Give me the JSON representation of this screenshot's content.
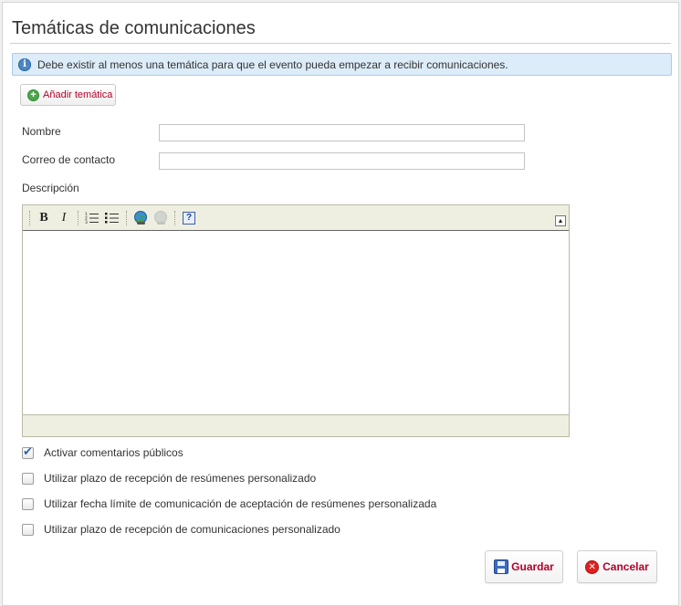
{
  "page": {
    "title": "Temáticas de comunicaciones"
  },
  "info": {
    "message": "Debe existir al menos una temática para que el evento pueda empezar a recibir comunicaciones.",
    "icon": "info-icon"
  },
  "add_button": {
    "label": "Añadir temática",
    "icon": "plus-circle-icon"
  },
  "form": {
    "name_label": "Nombre",
    "name_value": "",
    "email_label": "Correo de contacto",
    "email_value": "",
    "description_label": "Descripción",
    "description_value": ""
  },
  "editor_toolbar": {
    "bold": "B",
    "italic": "I",
    "help": "?",
    "tools": [
      "bold-icon",
      "italic-icon",
      "ordered-list-icon",
      "unordered-list-icon",
      "link-icon",
      "unlink-icon",
      "help-icon"
    ]
  },
  "checkboxes": [
    {
      "label": "Activar comentarios públicos",
      "checked": true
    },
    {
      "label": "Utilizar plazo de recepción de resúmenes personalizado",
      "checked": false
    },
    {
      "label": "Utilizar fecha límite de comunicación de aceptación de resúmenes personalizada",
      "checked": false
    },
    {
      "label": "Utilizar plazo de recepción de comunicaciones personalizado",
      "checked": false
    }
  ],
  "actions": {
    "save_label": "Guardar",
    "cancel_label": "Cancelar"
  },
  "colors": {
    "accent_text": "#b5002a",
    "info_bg": "#dcecf8",
    "editor_chrome": "#efefe1"
  }
}
